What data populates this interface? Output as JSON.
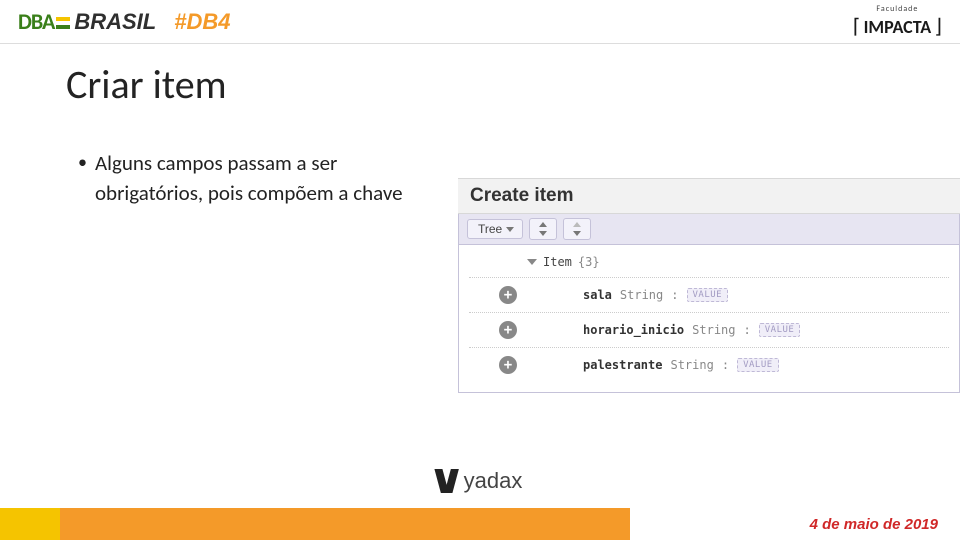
{
  "header": {
    "dba_text_1": "DBA",
    "brasil": "BRASIL",
    "db4": "#DB4",
    "impacta_top": "Faculdade",
    "impacta_name": "IMPACTA"
  },
  "title": "Criar item",
  "bullet": "Alguns campos passam a ser obrigatórios, pois compõem a chave",
  "panel": {
    "title": "Create item",
    "tree_label": "Tree",
    "root_label": "Item",
    "root_count": "{3}",
    "value_placeholder": "VALUE",
    "fields": [
      {
        "name": "sala",
        "type": "String"
      },
      {
        "name": "horario_inicio",
        "type": "String"
      },
      {
        "name": "palestrante",
        "type": "String"
      }
    ]
  },
  "footer": {
    "yadax": "yadax",
    "date": "4 de maio de 2019"
  }
}
